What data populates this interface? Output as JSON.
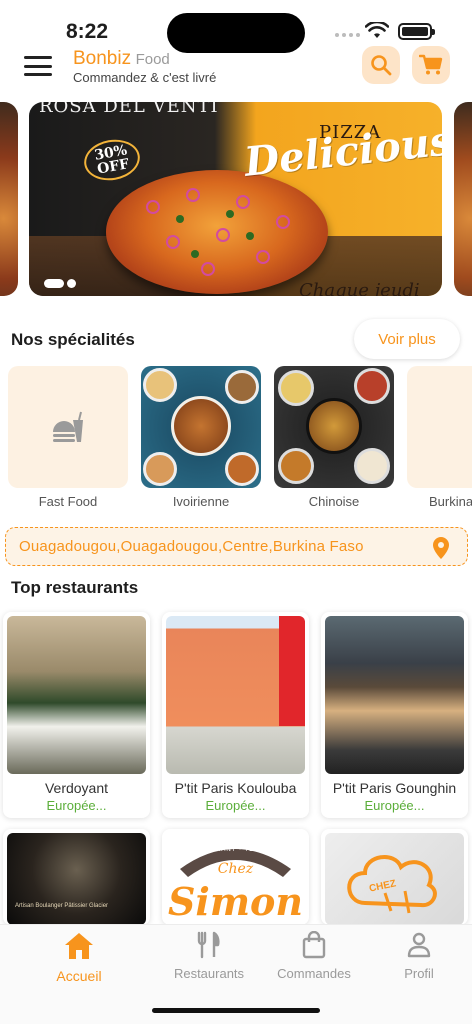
{
  "status": {
    "time": "8:22"
  },
  "header": {
    "brand": "Bonbiz",
    "brand_suffix": "Food",
    "tagline": "Commandez & c'est livré"
  },
  "banner": {
    "top_text": "ROSA DEL VENTI",
    "promo_percent": "30%",
    "promo_off": "OFF",
    "pizza_word": "PIZZA",
    "delicious": "Delicious",
    "footer_text": "Chaque jeudi"
  },
  "specialties": {
    "title": "Nos spécialités",
    "see_more": "Voir plus",
    "items": [
      {
        "label": "Fast Food",
        "icon": "fast-food-icon"
      },
      {
        "label": "Ivoirienne"
      },
      {
        "label": "Chinoise"
      },
      {
        "label": "Burkinabè",
        "icon": "fast-food-icon"
      }
    ]
  },
  "location": {
    "text": "Ouagadougou,Ouagadougou,Centre,Burkina Faso",
    "icon": "map-pin-icon"
  },
  "top_restaurants": {
    "title": "Top restaurants",
    "items": [
      {
        "name": "Verdoyant",
        "category": "Europée..."
      },
      {
        "name": "P'tit Paris Koulouba",
        "category": "Europée..."
      },
      {
        "name": "P'tit Paris Gounghin",
        "category": "Europée..."
      },
      {
        "name": "",
        "category": "",
        "sign": "Artisan Boulanger Pâtissier Glacier"
      },
      {
        "name": "",
        "category": "",
        "logo_top": "RESTAURANT · TERRASSE",
        "logo_chez": "Chez",
        "logo_name": "Simon"
      },
      {
        "name": "",
        "category": "",
        "logo_text": "CHEZ"
      }
    ]
  },
  "bottom_nav": {
    "items": [
      {
        "label": "Accueil",
        "icon": "home-icon",
        "active": true
      },
      {
        "label": "Restaurants",
        "icon": "fork-knife-icon"
      },
      {
        "label": "Commandes",
        "icon": "shopping-bag-icon"
      },
      {
        "label": "Profil",
        "icon": "user-icon"
      }
    ]
  },
  "colors": {
    "accent": "#f7941d",
    "accent_light": "#fde4c8",
    "category_green": "#5bae3a"
  }
}
